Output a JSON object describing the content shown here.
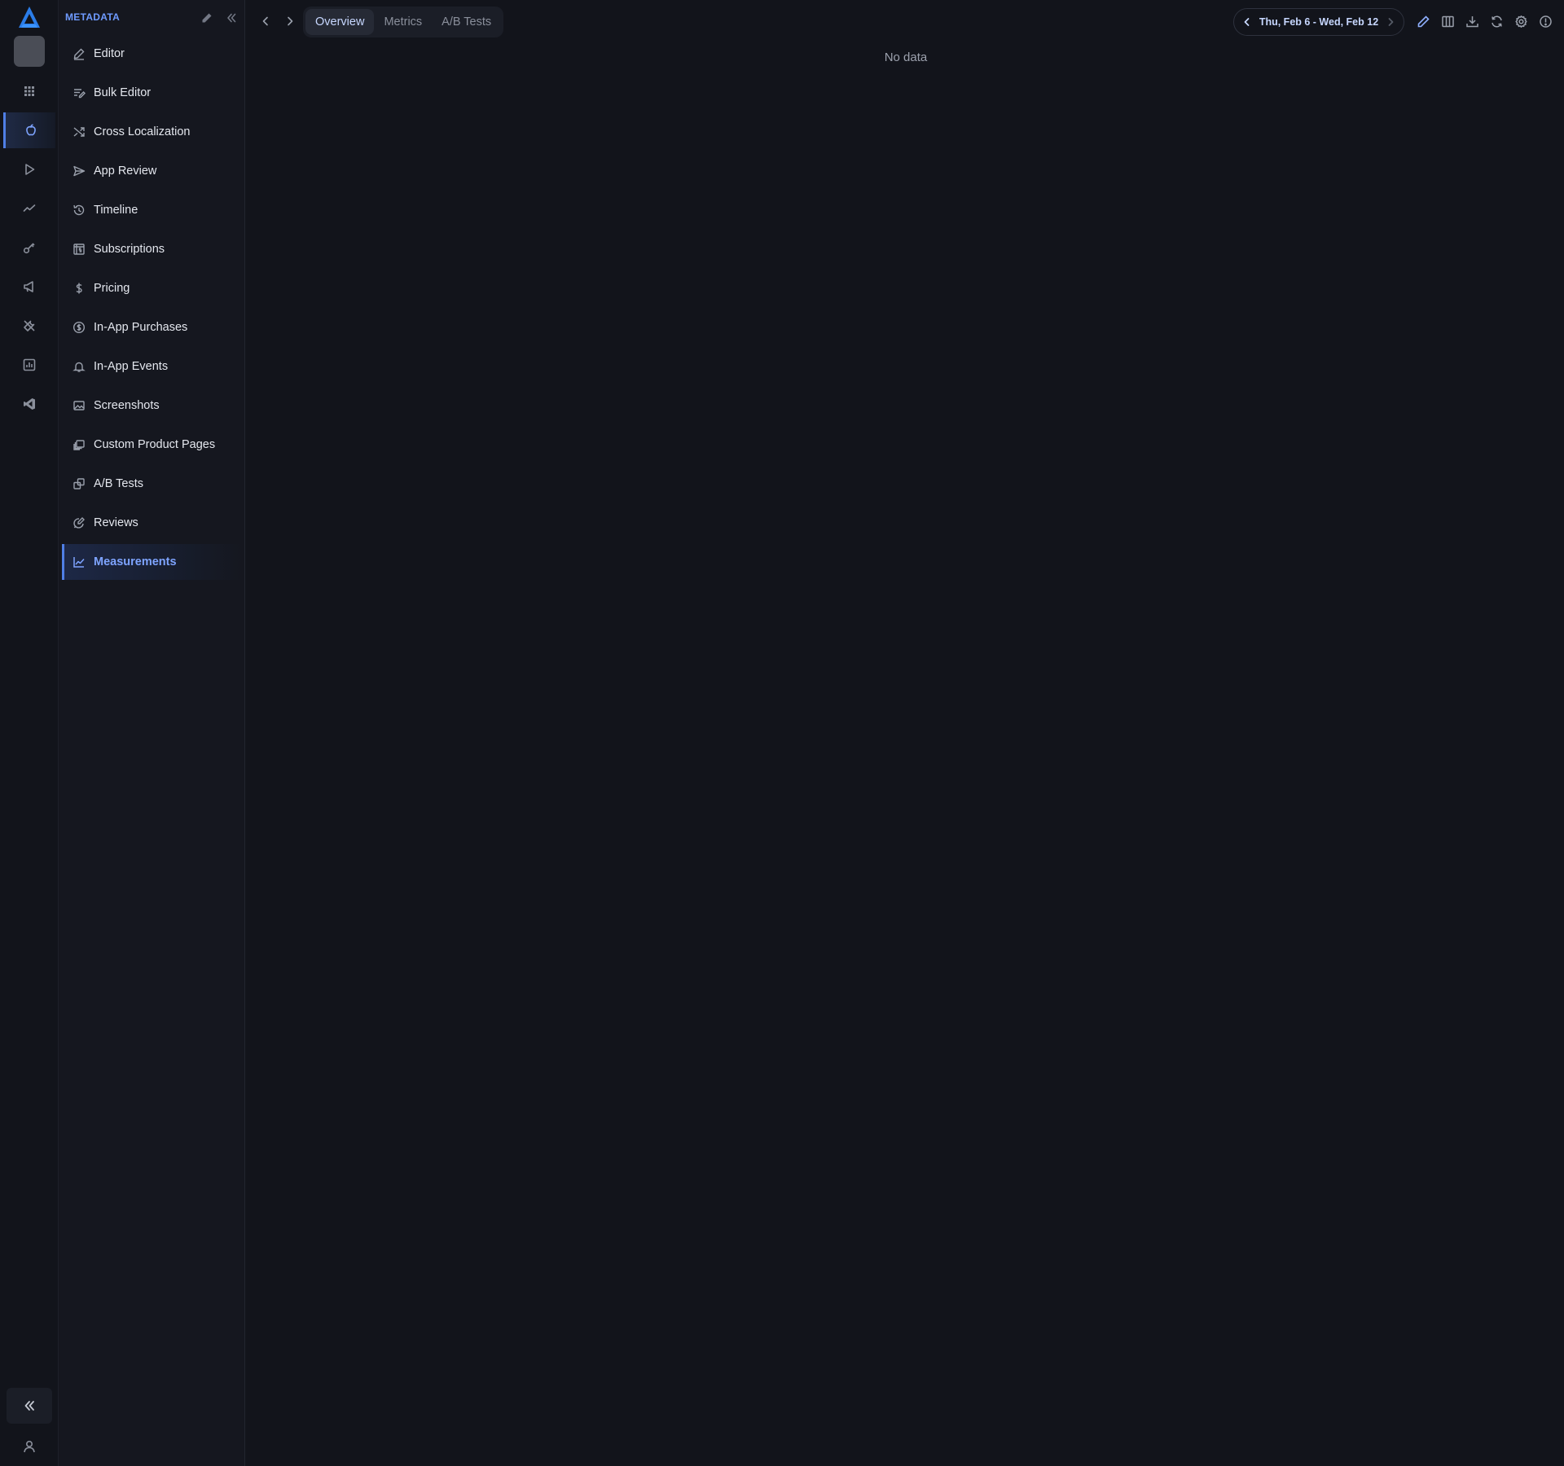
{
  "rail": {
    "logo": "app-logo",
    "items": [
      {
        "id": "apps",
        "icon": "grid-icon"
      },
      {
        "id": "app-store",
        "icon": "apple-icon",
        "active": true
      },
      {
        "id": "google-play",
        "icon": "play-icon"
      },
      {
        "id": "analytics",
        "icon": "trend-icon"
      },
      {
        "id": "keywords",
        "icon": "key-icon"
      },
      {
        "id": "campaigns",
        "icon": "megaphone-icon"
      },
      {
        "id": "tools",
        "icon": "tools-icon"
      },
      {
        "id": "reports",
        "icon": "chart-box-icon"
      },
      {
        "id": "integrations",
        "icon": "code-icon"
      }
    ]
  },
  "sidebar": {
    "title": "METADATA",
    "items": [
      {
        "label": "Editor",
        "icon": "pencil-icon"
      },
      {
        "label": "Bulk Editor",
        "icon": "bulk-edit-icon"
      },
      {
        "label": "Cross Localization",
        "icon": "shuffle-icon"
      },
      {
        "label": "App Review",
        "icon": "send-icon"
      },
      {
        "label": "Timeline",
        "icon": "history-icon"
      },
      {
        "label": "Subscriptions",
        "icon": "subscriptions-icon"
      },
      {
        "label": "Pricing",
        "icon": "dollar-icon"
      },
      {
        "label": "In-App Purchases",
        "icon": "coin-icon"
      },
      {
        "label": "In-App Events",
        "icon": "bell-icon"
      },
      {
        "label": "Screenshots",
        "icon": "image-icon"
      },
      {
        "label": "Custom Product Pages",
        "icon": "stack-icon"
      },
      {
        "label": "A/B Tests",
        "icon": "ab-icon"
      },
      {
        "label": "Reviews",
        "icon": "review-icon"
      },
      {
        "label": "Measurements",
        "icon": "line-chart-icon",
        "active": true
      }
    ]
  },
  "topbar": {
    "tabs": [
      {
        "label": "Overview",
        "active": true
      },
      {
        "label": "Metrics"
      },
      {
        "label": "A/B Tests"
      }
    ],
    "date_range": "Thu, Feb 6 - Wed, Feb 12"
  },
  "main": {
    "empty_text": "No data"
  },
  "colors": {
    "background": "#12141b",
    "sidebar": "#15171f",
    "accent": "#4f7fe6",
    "accent_text": "#7ea4ff"
  }
}
